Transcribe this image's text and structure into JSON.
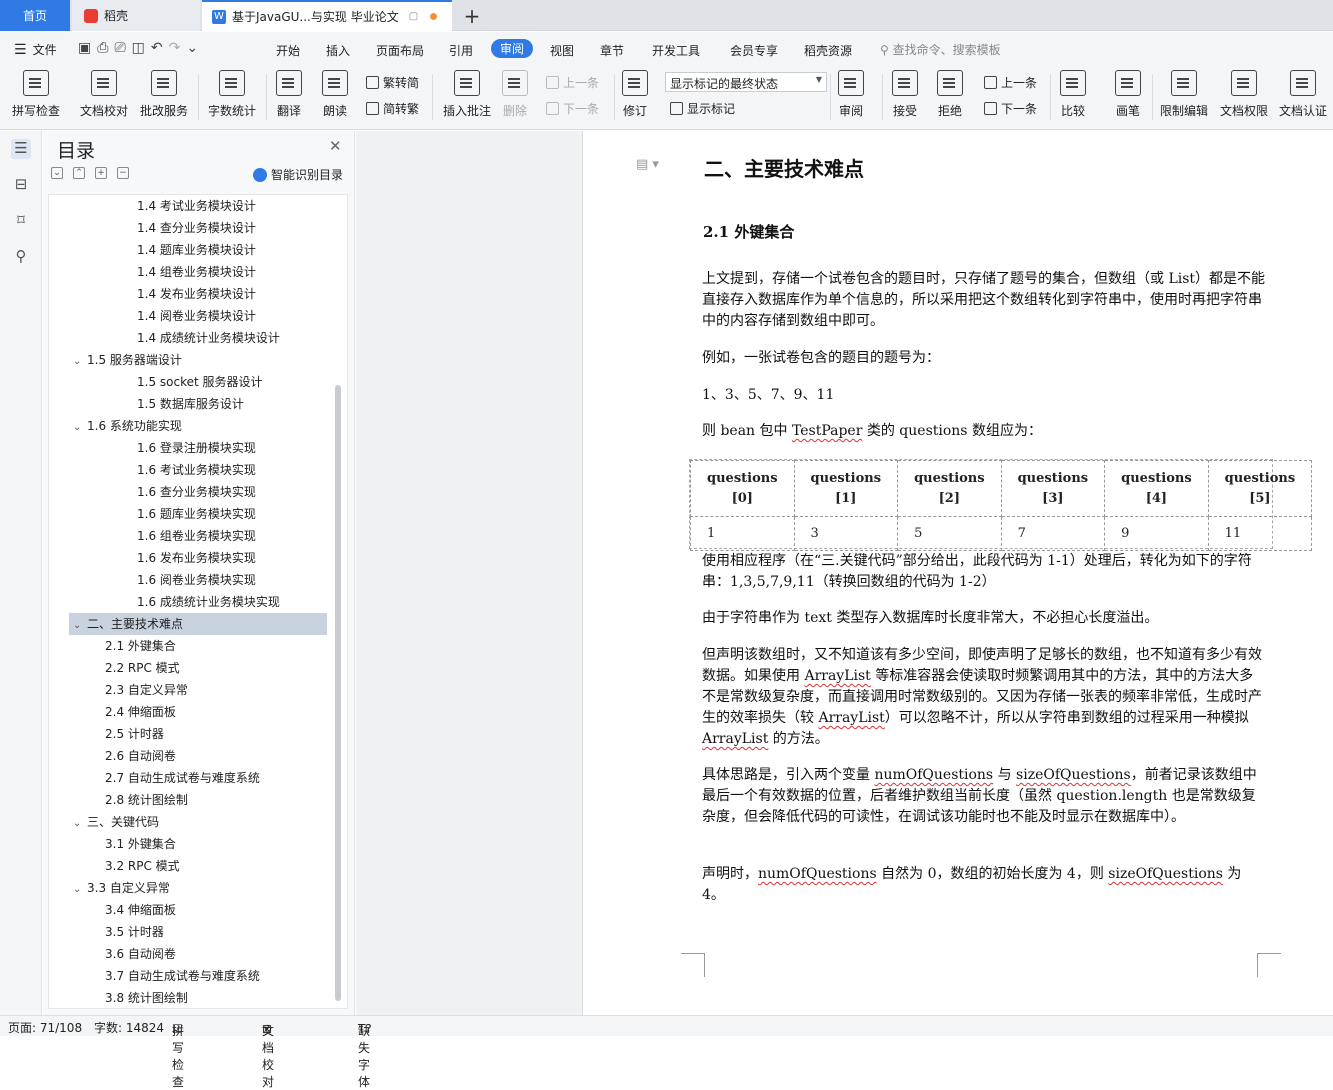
{
  "tabs": {
    "home": "首页",
    "daoke": "稻壳",
    "doc": "基于JavaGU...与实现 毕业论文",
    "plus": "+"
  },
  "menu": {
    "file": "文件",
    "tabs": [
      "开始",
      "插入",
      "页面布局",
      "引用",
      "审阅",
      "视图",
      "章节",
      "开发工具",
      "会员专享",
      "稻壳资源"
    ],
    "active_tab": "审阅",
    "search": "查找命令、搜索模板"
  },
  "ribbon": {
    "spell": "拼写检查",
    "proof": "文档校对",
    "annot_service": "批改服务",
    "wordcount": "字数统计",
    "translate": "翻译",
    "read": "朗读",
    "to_trad": "繁转简",
    "to_simp": "简转繁",
    "insert_comment": "插入批注",
    "delete": "删除",
    "prev": "上一条",
    "next": "下一条",
    "revise": "修订",
    "markup_select": "显示标记的最终状态",
    "show_markup": "显示标记",
    "review": "审阅",
    "accept": "接受",
    "reject": "拒绝",
    "prev2": "上一条",
    "next2": "下一条",
    "compare": "比较",
    "pen": "画笔",
    "restrict": "限制编辑",
    "perm": "文档权限",
    "cert": "文档认证"
  },
  "toc": {
    "title": "目录",
    "smart": "智能识别目录",
    "items": [
      {
        "text": "1.4  考试业务模块设计",
        "level": 3
      },
      {
        "text": "1.4  查分业务模块设计",
        "level": 3
      },
      {
        "text": "1.4  题库业务模块设计",
        "level": 3
      },
      {
        "text": "1.4  组卷业务模块设计",
        "level": 3
      },
      {
        "text": "1.4  发布业务模块设计",
        "level": 3
      },
      {
        "text": "1.4  阅卷业务模块设计",
        "level": 3
      },
      {
        "text": "1.4  成绩统计业务模块设计",
        "level": 3
      },
      {
        "text": "1.5  服务器端设计",
        "level": 1,
        "open": true
      },
      {
        "text": "1.5 socket  服务器设计",
        "level": 3
      },
      {
        "text": "1.5  数据库服务设计",
        "level": 3
      },
      {
        "text": "1.6  系统功能实现",
        "level": 1,
        "open": true
      },
      {
        "text": "1.6  登录注册模块实现",
        "level": 3
      },
      {
        "text": "1.6  考试业务模块实现",
        "level": 3
      },
      {
        "text": "1.6  查分业务模块实现",
        "level": 3
      },
      {
        "text": "1.6  题库业务模块实现",
        "level": 3
      },
      {
        "text": "1.6  组卷业务模块实现",
        "level": 3
      },
      {
        "text": "1.6  发布业务模块实现",
        "level": 3
      },
      {
        "text": "1.6  阅卷业务模块实现",
        "level": 3
      },
      {
        "text": "1.6  成绩统计业务模块实现",
        "level": 3
      },
      {
        "text": "二、主要技术难点",
        "level": 0,
        "open": true,
        "selected": true
      },
      {
        "text": "2.1  外键集合",
        "level": 2
      },
      {
        "text": "2.2 RPC  模式",
        "level": 2
      },
      {
        "text": "2.3  自定义异常",
        "level": 2
      },
      {
        "text": "2.4  伸缩面板",
        "level": 2
      },
      {
        "text": "2.5  计时器",
        "level": 2
      },
      {
        "text": "2.6  自动阅卷",
        "level": 2
      },
      {
        "text": "2.7  自动生成试卷与难度系统",
        "level": 2
      },
      {
        "text": "2.8  统计图绘制",
        "level": 2
      },
      {
        "text": "三、关键代码",
        "level": 0,
        "open": true
      },
      {
        "text": "3.1  外键集合",
        "level": 2
      },
      {
        "text": "3.2 RPC  模式",
        "level": 2
      },
      {
        "text": "3.3  自定义异常",
        "level": 1,
        "open": true
      },
      {
        "text": "3.4  伸缩面板",
        "level": 2
      },
      {
        "text": "3.5  计时器",
        "level": 2
      },
      {
        "text": "3.6  自动阅卷",
        "level": 2
      },
      {
        "text": "3.7  自动生成试卷与难度系统",
        "level": 2
      },
      {
        "text": "3.8  统计图绘制",
        "level": 2
      }
    ]
  },
  "doc": {
    "h1": "二、主要技术难点",
    "h2": "2.1  外键集合",
    "p1": "上文提到，存储一个试卷包含的题目时，只存储了题号的集合，但数组（或 List）都是不能直接存入数据库作为单个信息的，所以采用把这个数组转化到字符串中，使用时再把字符串中的内容存储到数组中即可。",
    "p2": "例如，一张试卷包含的题目的题号为：",
    "p3": "1、3、5、7、9、11",
    "p4a": "则  bean  包中  ",
    "p4b": "TestPaper",
    "p4c": "  类的  questions  数组应为：",
    "table_head": [
      "questions [0]",
      "questions [1]",
      "questions [2]",
      "questions [3]",
      "questions [4]",
      "questions [5]"
    ],
    "table_row": [
      "1",
      "3",
      "5",
      "7",
      "9",
      "11"
    ],
    "p5": "使用相应程序（在“三.关键代码”部分给出，此段代码为  1-1）处理后，转化为如下的字符串：1,3,5,7,9,11（转换回数组的代码为  1-2）",
    "p6": "由于字符串作为  text  类型存入数据库时长度非常大，不必担心长度溢出。",
    "p7a": "但声明该数组时，又不知道该有多少空间，即使声明了足够长的数组，也不知道有多少有效数据。如果使用  ",
    "p7b": "ArrayList",
    "p7c": "  等标准容器会使读取时频繁调用其中的方法，其中的方法大多不是常数级复杂度，而直接调用时常数级别的。又因为存储一张表的频率非常低，生成时产生的效率损失（较  ",
    "p7d": "ArrayList",
    "p7e": "）可以忽略不计，所以从字符串到数组的过程采用一种模拟  ",
    "p7f": "ArrayList",
    "p7g": "  的方法。",
    "p8a": "具体思路是，引入两个变量  ",
    "p8b": "numOfQuestions",
    "p8c": "  与  ",
    "p8d": "sizeOfQuestions",
    "p8e": "，前者记录该数组中最后一个有效数据的位置，后者维护数组当前长度（虽然  question.length  也是常数级复杂度，但会降低代码的可读性，在调试该功能时也不能及时显示在数据库中）。",
    "p9a": "声明时，",
    "p9b": "numOfQuestions",
    "p9c": "  自然为  0，数组的初始长度为  4，则  ",
    "p9d": "sizeOfQuestions",
    "p9e": "  为 4。"
  },
  "status": {
    "page": "页面: 71/108",
    "words": "字数: 14824",
    "spell": "拼写检查",
    "proof": "文档校对",
    "font": "缺失字体"
  },
  "colors": {
    "accent": "#2f7ae5"
  }
}
